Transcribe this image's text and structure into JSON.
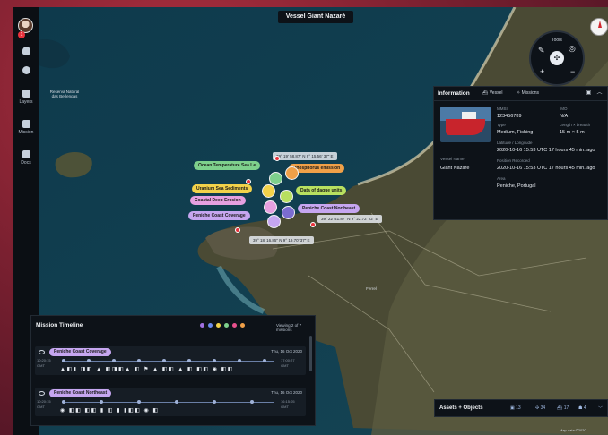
{
  "title": "Vessel Giant Nazaré",
  "sidebar": {
    "badge": "1",
    "items": [
      {
        "label": "",
        "icon": "notification-icon"
      },
      {
        "label": "",
        "icon": "settings-icon"
      },
      {
        "label": "Layers",
        "icon": "layers-icon"
      },
      {
        "label": "Mission",
        "icon": "mission-icon"
      },
      {
        "label": "Docs",
        "icon": "docs-icon"
      }
    ]
  },
  "tools": {
    "label": "Tools",
    "center_icon": "drone-icon"
  },
  "info": {
    "title": "Information",
    "tab_vessel": "Vessel",
    "tab_missions": "Missions",
    "fields": {
      "mmsi_label": "MMSI",
      "mmsi": "123456789",
      "imo_label": "IMO",
      "imo": "N/A",
      "type_label": "Type",
      "type": "Medium, Fishing",
      "size_label": "Length × breadth",
      "size": "15 m × 5 m",
      "name_label": "Vessel Name",
      "name": "Giant Nazaré",
      "pos_label": "Latitude / Longitude",
      "pos": "2020-10-16 15:53 UTC 17 hours 45 min. ago",
      "detected_label": "Position Recorded",
      "detected": "2020-10-16 15:53 UTC 17 hours 45 min. ago",
      "area_label": "Area",
      "area": "Peniche, Portugal"
    }
  },
  "map_labels": {
    "reserve": "Reserva Natural das Berlengas",
    "town": "Ferrel"
  },
  "tags": [
    {
      "text": "Ocean Temperature Sea Le",
      "color": "#7ed08c"
    },
    {
      "text": "Phosphorus emission",
      "color": "#f0a048"
    },
    {
      "text": "Uranium Sea Sediments",
      "color": "#f2d24a"
    },
    {
      "text": "Coastal Deep Erosion",
      "color": "#e6a0e0"
    },
    {
      "text": "Peniche Coast Coverage",
      "color": "#c6a6f0"
    },
    {
      "text": "Data of dague units",
      "color": "#b8e060"
    },
    {
      "text": "Peniche Coast Northeast",
      "color": "#c6a6f0"
    }
  ],
  "coords": [
    "39° 19' 58.87\" N 9° 15.56' 37\" E",
    "39° 22' 41.87\" N 9° 22.72' 22\" E",
    "39° 18' 16.85\" N 9° 19.70' 37\" E"
  ],
  "timeline": {
    "title": "Mission Timeline",
    "viewing": "Viewing 2 of 7 missions",
    "dot_colors": [
      "#a070e0",
      "#6a8af0",
      "#f2d24a",
      "#7ed08c",
      "#e8508c",
      "#f0a048"
    ],
    "rows": [
      {
        "name": "Peniche Coast Coverage",
        "date": "Thu, 16 Oct 2020",
        "start": "10:20:15",
        "start_tz": "GMT",
        "end": "17:00:27",
        "end_tz": "GMT",
        "icons": "▲◧▮ ◨◧ ▲ ◧◨◧▲ ◧ ⚑ ▲   ◧◧ ▲ ◧ ◧◧   ◉ ◧◧"
      },
      {
        "name": "Peniche Coast Northeast",
        "date": "Thu, 16 Oct 2020",
        "start": "10:20:15",
        "start_tz": "GMT",
        "end": "16:15:05",
        "end_tz": "GMT",
        "icons": "◉     ◧◧      ◧◧  ▮  ◧  ▮   ▮◧◧  ◉  ◧"
      }
    ]
  },
  "assets": {
    "title": "Assets + Objects",
    "counts": [
      "13",
      "34",
      "17",
      "4"
    ]
  },
  "attribution": "Map data ©2020"
}
